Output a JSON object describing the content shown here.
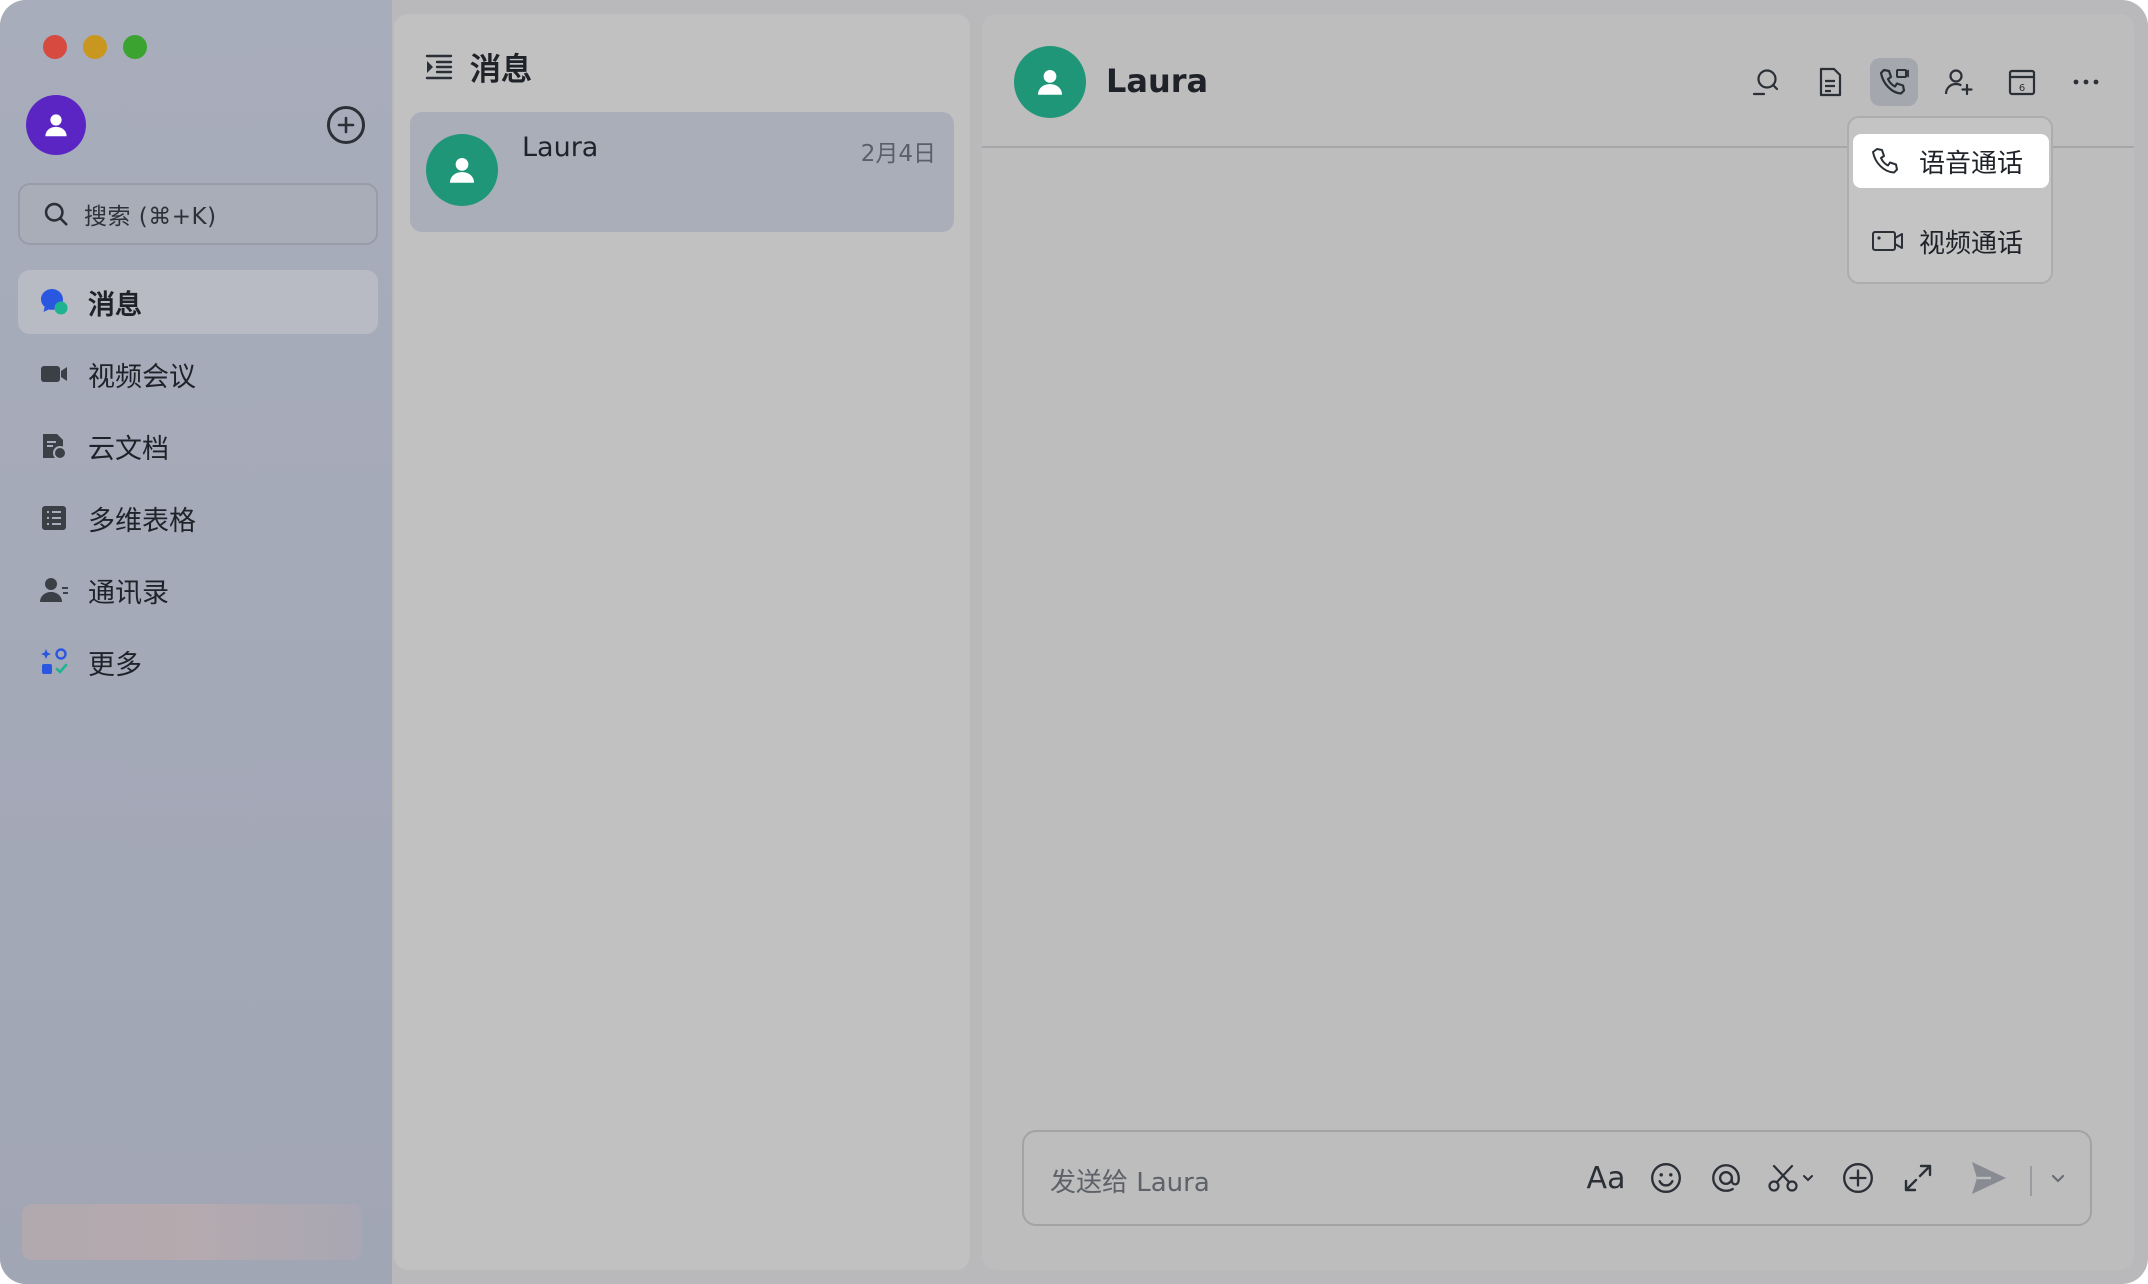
{
  "sidebar": {
    "search_label": "搜索 (⌘+K)",
    "items": [
      {
        "label": "消息",
        "icon": "message-bubble-icon"
      },
      {
        "label": "视频会议",
        "icon": "video-camera-icon"
      },
      {
        "label": "云文档",
        "icon": "cloud-document-icon"
      },
      {
        "label": "多维表格",
        "icon": "table-icon"
      },
      {
        "label": "通讯录",
        "icon": "contacts-icon"
      },
      {
        "label": "更多",
        "icon": "more-apps-icon"
      }
    ]
  },
  "conversation_list": {
    "title": "消息",
    "items": [
      {
        "name": "Laura",
        "date": "2月4日"
      }
    ]
  },
  "chat": {
    "contact_name": "Laura",
    "toolbar_icons": [
      "search-chat-icon",
      "document-icon",
      "phone-call-icon",
      "add-member-icon",
      "calendar-icon",
      "more-icon"
    ],
    "calendar_day": "6",
    "call_menu": {
      "voice_call": "语音通话",
      "video_call": "视频通话"
    },
    "composer_placeholder": "发送给 Laura",
    "format_icon_text": "Aa"
  },
  "colors": {
    "me_avatar": "#5b25c4",
    "contact_avatar": "#1f9678",
    "close": "#d64a3f",
    "minimize": "#c9961f",
    "zoom": "#3ba330"
  }
}
